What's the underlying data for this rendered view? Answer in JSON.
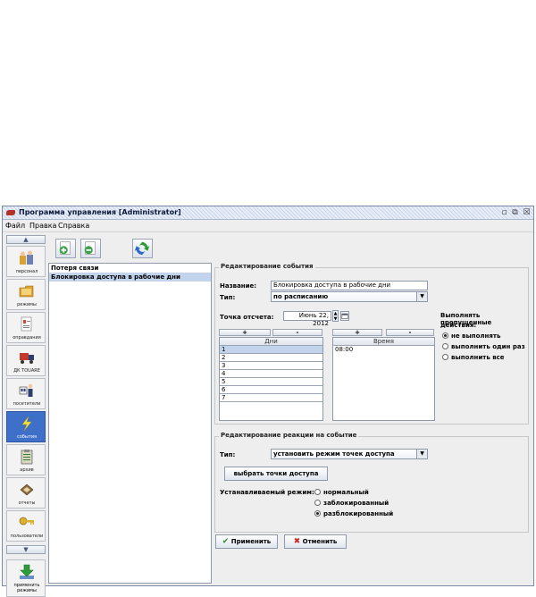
{
  "window": {
    "title": "Программа управления [Administrator]",
    "controls": {
      "minimize": "▫",
      "restore": "⧉",
      "close": "☒"
    }
  },
  "menu": [
    "Файл",
    "Правка",
    "Справка"
  ],
  "sidebar": {
    "scroll_up": "▲",
    "scroll_down": "▼",
    "items": [
      {
        "label": "персонал",
        "icon": "people-icon"
      },
      {
        "label": "режимы",
        "icon": "folder-icon"
      },
      {
        "label": "оправдания",
        "icon": "document-icon"
      },
      {
        "label": "ДК TOUARE",
        "icon": "truck-icon"
      },
      {
        "label": "посетители",
        "icon": "visitor-icon"
      },
      {
        "label": "события",
        "icon": "lightning-icon"
      },
      {
        "label": "архив",
        "icon": "clipboard-icon"
      },
      {
        "label": "отчеты",
        "icon": "report-icon"
      },
      {
        "label": "пользователи",
        "icon": "key-icon"
      }
    ],
    "active_index": 5,
    "apply": {
      "line1": "применить",
      "line2": "режимы",
      "icon": "download-arrow-icon"
    }
  },
  "toolbar": {
    "add": "add-icon",
    "remove": "remove-icon",
    "refresh": "refresh-icon"
  },
  "event_list": [
    "Потеря связи",
    "Блокировка доступа в рабочие дни"
  ],
  "event_list_selected": 1,
  "edit_event": {
    "title": "Редактирование события",
    "name_label": "Название:",
    "name_value": "Блокировка доступа в рабочие дни",
    "type_label": "Тип:",
    "type_value": "по расписанию",
    "ref_label": "Точка отсчета:",
    "ref_value": "Июнь 22, 2012",
    "plus": "+",
    "minus": "-",
    "days_header": "Дни",
    "days": [
      "1",
      "2",
      "3",
      "4",
      "5",
      "6",
      "7"
    ],
    "time_header": "Время",
    "times": [
      "08:00"
    ],
    "missed_title_1": "Выполнять пропущенные",
    "missed_title_2": "действия:",
    "missed_options": [
      "не выполнять",
      "выполнить один раз",
      "выполнить все"
    ],
    "missed_selected": 0
  },
  "edit_reaction": {
    "title": "Редактирование реакции на событие",
    "type_label": "Тип:",
    "type_value": "установить режим точек доступа",
    "select_points": "выбрать точки доступа",
    "mode_label": "Устанавливаемый режим:",
    "modes": [
      "нормальный",
      "заблокированный",
      "разблокированный"
    ],
    "mode_selected": 2
  },
  "buttons": {
    "apply": "Применить",
    "cancel": "Отменить"
  },
  "colors": {
    "active_nav": "#3e6fc9",
    "selection": "#c2d3ec",
    "apply_check": "#2e8b2e",
    "cancel_x": "#cc2a1f"
  }
}
